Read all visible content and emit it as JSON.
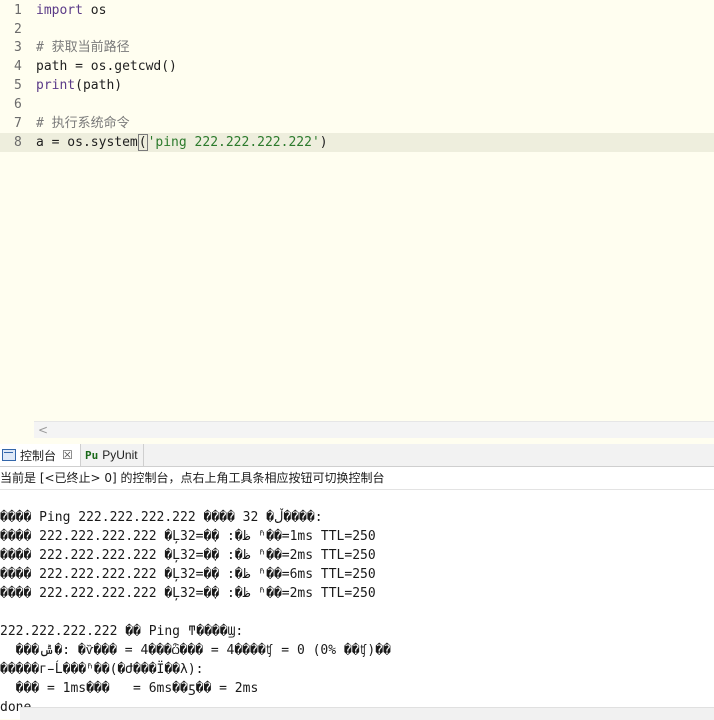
{
  "editor": {
    "lines": [
      {
        "num": "1",
        "text": "import os"
      },
      {
        "num": "2",
        "text": ""
      },
      {
        "num": "3",
        "text": "# 获取当前路径"
      },
      {
        "num": "4",
        "text": "path = os.getcwd()"
      },
      {
        "num": "5",
        "text": "print(path)"
      },
      {
        "num": "6",
        "text": ""
      },
      {
        "num": "7",
        "text": "# 执行系统命令"
      },
      {
        "num": "8",
        "text": "a = os.system('ping 222.222.222.222')"
      }
    ],
    "current_line": 8
  },
  "hscroll": {
    "left_arrow": "<"
  },
  "tabs": {
    "console_label": "控制台",
    "console_close": "☒",
    "pyunit_label": "PyUnit"
  },
  "console": {
    "status": "当前是 [<已终止> 0] 的控制台，点右上角工具条相应按钮可切换控制台",
    "output": [
      "���� Ping 222.222.222.222 ���� 32 �ֽڵ����:",
      "���� 222.222.222.222 �Ļظ�: �ֽ�=32 ʱ��=1ms TTL=250",
      "���� 222.222.222.222 �Ļظ�: �ֽ�=32 ʱ��=2ms TTL=250",
      "���� 222.222.222.222 �Ļظ�: �ֽ�=32 ʱ��=6ms TTL=250",
      "���� 222.222.222.222 �Ļظ�: �ֽ�=32 ʱ��=2ms TTL=250",
      "",
      "222.222.222.222 �� Ping ͳ����Ϣ:",
      "  ���ݰ�: �ѷ��� = 4���ѽ��� = 4����ʧ = 0 (0% ��ʧ)��",
      "�����г̵Ĺ���ʱ��(�Ժ���Ϊ��λ):",
      "  ��� = 1ms���   = 6ms��ƽ�� = 2ms",
      "done"
    ]
  },
  "colors": {
    "editor_bg": "#fffef0",
    "current_line_bg": "#eeeedd",
    "keyword": "#5b3b88",
    "comment": "#7a7a7a",
    "string": "#2b7a2b"
  }
}
